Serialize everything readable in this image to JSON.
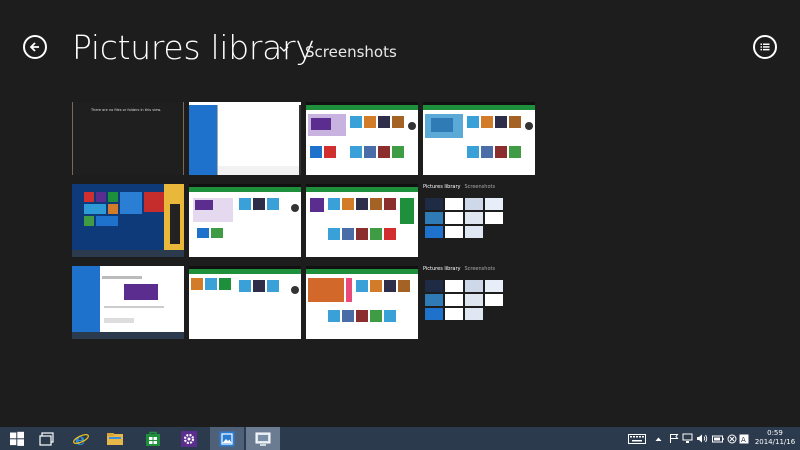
{
  "header": {
    "title": "Pictures library",
    "subtitle": "Screenshots",
    "back_icon": "back-arrow-icon",
    "menu_icon": "list-view-icon"
  },
  "grid": {
    "empty_message": "There are no files or folders in this view.",
    "folders": [
      {
        "name": "Pictures library",
        "sub": "Screenshots"
      },
      {
        "name": "Pictures library",
        "sub": "Screenshots"
      }
    ]
  },
  "taskbar": {
    "apps": [
      "start-icon",
      "file-explorer-icon",
      "internet-explorer-icon",
      "folder-icon",
      "store-icon",
      "settings-icon",
      "photos-icon",
      "desktop-app-icon"
    ],
    "time": "0:59",
    "date": "2014/11/16"
  },
  "colors": {
    "background": "#1d1d1d",
    "taskbar": "#2c3a4d",
    "accent_green": "#1e8f3a",
    "accent_purple": "#5b2d8e",
    "accent_blue": "#1f72cc"
  }
}
